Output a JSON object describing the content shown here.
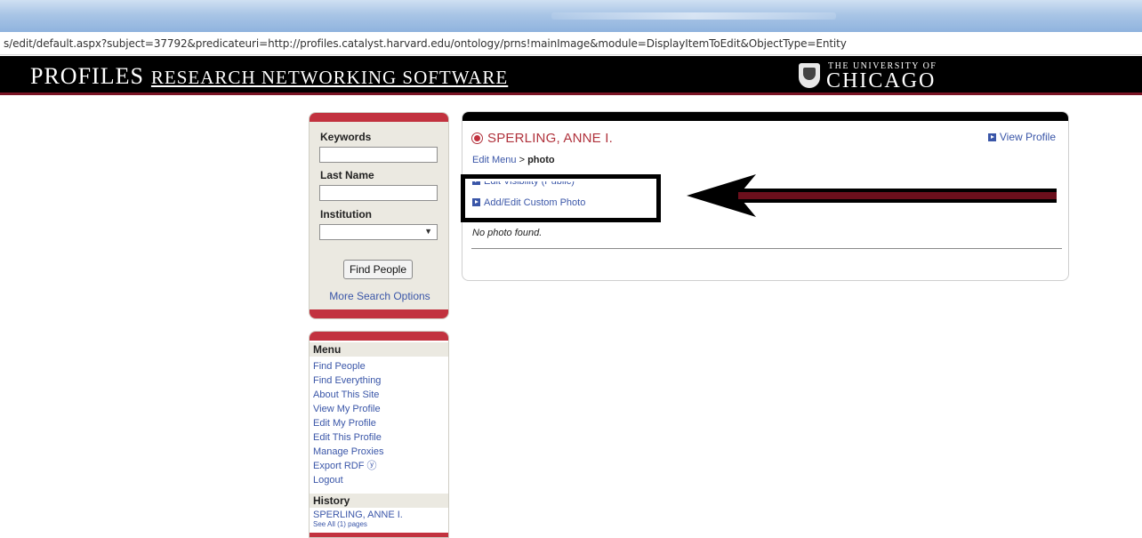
{
  "browser": {
    "url": "s/edit/default.aspx?subject=37792&predicateuri=http://profiles.catalyst.harvard.edu/ontology/prns!mainImage&module=DisplayItemToEdit&ObjectType=Entity"
  },
  "header": {
    "brand_main": "PROFILES",
    "brand_sub": "RESEARCH NETWORKING SOFTWARE",
    "university_top": "THE UNIVERSITY OF",
    "university_name": "CHICAGO"
  },
  "search": {
    "keywords_label": "Keywords",
    "keywords_value": "",
    "lastname_label": "Last Name",
    "lastname_value": "",
    "institution_label": "Institution",
    "institution_value": "",
    "find_button": "Find People",
    "more_options": "More Search Options"
  },
  "menu": {
    "title": "Menu",
    "items": [
      "Find People",
      "Find Everything",
      "About This Site",
      "View My Profile",
      "Edit My Profile",
      "Edit This Profile",
      "Manage Proxies",
      "Export RDF ⓨ",
      "Logout"
    ],
    "history_title": "History",
    "history_item": "SPERLING, ANNE I.",
    "see_all": "See All (1) pages"
  },
  "profile": {
    "name": "SPERLING, ANNE I.",
    "view_profile": "View Profile",
    "crumb_link": "Edit Menu",
    "crumb_sep": " > ",
    "crumb_current": "photo",
    "edit_visibility": "Edit Visibility (Public)",
    "add_custom_photo": "Add/Edit Custom Photo",
    "no_photo": "No photo found."
  },
  "colors": {
    "accent_red": "#c2323f",
    "link_blue": "#3a56a8",
    "header_black": "#000000"
  }
}
